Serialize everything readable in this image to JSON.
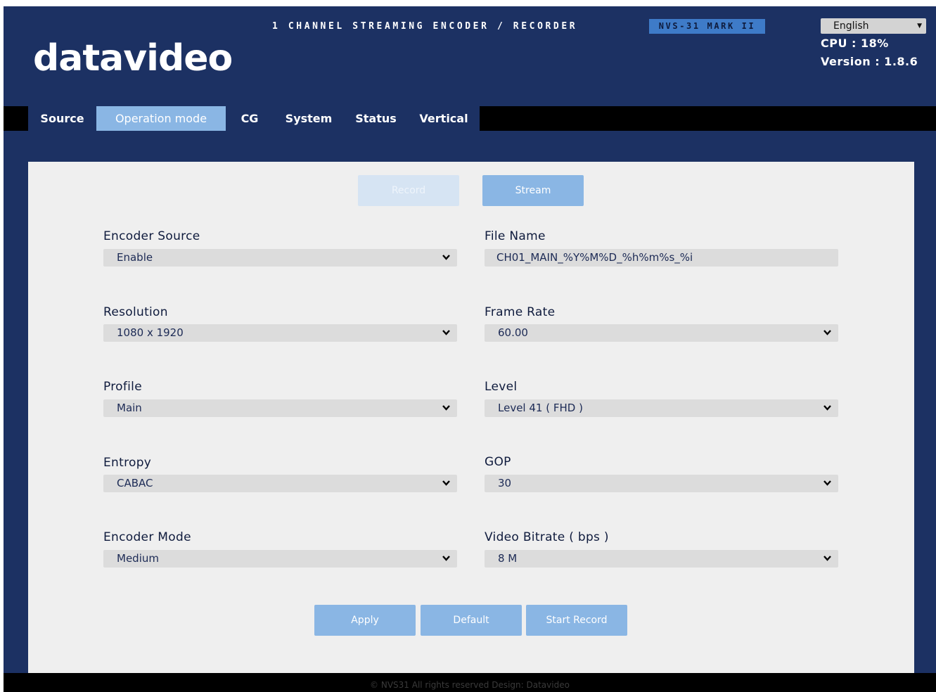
{
  "header": {
    "logo_text": "datavideo",
    "product_title": "1 CHANNEL STREAMING ENCODER / RECORDER",
    "model": "NVS-31 MARK II",
    "language": "English",
    "cpu": "CPU  : 18%",
    "version": "Version : 1.8.6"
  },
  "nav": {
    "tabs": [
      {
        "label": "Source"
      },
      {
        "label": "Operation mode"
      },
      {
        "label": "CG"
      },
      {
        "label": "System"
      },
      {
        "label": "Status"
      },
      {
        "label": "Vertical"
      }
    ],
    "active": "Operation mode"
  },
  "mode": {
    "record_label": "Record",
    "stream_label": "Stream"
  },
  "fields": {
    "encoder_source": {
      "label": "Encoder Source",
      "value": "Enable"
    },
    "file_name": {
      "label": "File Name",
      "value": "CH01_MAIN_%Y%M%D_%h%m%s_%i"
    },
    "resolution": {
      "label": "Resolution",
      "value": "1080 x 1920"
    },
    "frame_rate": {
      "label": "Frame Rate",
      "value": "60.00"
    },
    "profile": {
      "label": "Profile",
      "value": "Main"
    },
    "level": {
      "label": "Level",
      "value": "Level 41 ( FHD )"
    },
    "entropy": {
      "label": "Entropy",
      "value": "CABAC"
    },
    "gop": {
      "label": "GOP",
      "value": "30"
    },
    "encoder_mode": {
      "label": "Encoder Mode",
      "value": "Medium"
    },
    "video_bitrate": {
      "label": "Video Bitrate ( bps )",
      "value": "8 M"
    }
  },
  "actions": {
    "apply": "Apply",
    "default": "Default",
    "start_record": "Start Record"
  },
  "footer": "© NVS31 All rights reserved Design: Datavideo",
  "colors": {
    "background": "#1c3163",
    "accent": "#8ab6e4",
    "panel": "#efefef"
  }
}
